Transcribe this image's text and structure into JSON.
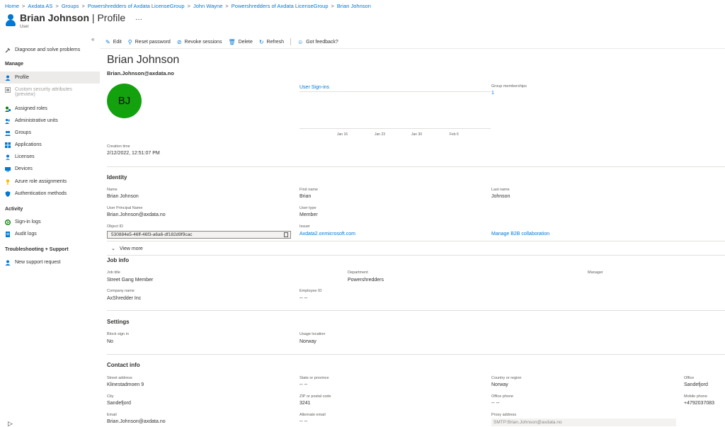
{
  "breadcrumb": [
    "Home",
    "Axdata AS",
    "Groups",
    "Powershredders of Axdata LicenseGroup",
    "John Wayne",
    "Powershredders of Axdata LicenseGroup",
    "Brian Johnson"
  ],
  "header": {
    "name": "Brian Johnson",
    "page": "Profile",
    "subtitle": "User",
    "more": "···"
  },
  "sidebar": {
    "collapse": "«",
    "diagnose": "Diagnose and solve problems",
    "manage_head": "Manage",
    "manage": [
      {
        "label": "Profile",
        "icon": "user-icon",
        "color": "#0078d4"
      },
      {
        "label": "Custom security attributes",
        "label2": "(preview)",
        "icon": "security-attributes-icon",
        "color": "#a19f9d"
      },
      {
        "label": "Assigned roles",
        "icon": "roles-icon",
        "color": "#107c10"
      },
      {
        "label": "Administrative units",
        "icon": "admin-units-icon",
        "color": "#0078d4"
      },
      {
        "label": "Groups",
        "icon": "groups-icon",
        "color": "#0078d4"
      },
      {
        "label": "Applications",
        "icon": "applications-icon",
        "color": "#0078d4"
      },
      {
        "label": "Licenses",
        "icon": "licenses-icon",
        "color": "#0078d4"
      },
      {
        "label": "Devices",
        "icon": "devices-icon",
        "color": "#0078d4"
      },
      {
        "label": "Azure role assignments",
        "icon": "key-icon",
        "color": "#ffb900"
      },
      {
        "label": "Authentication methods",
        "icon": "shield-icon",
        "color": "#0078d4"
      }
    ],
    "activity_head": "Activity",
    "activity": [
      {
        "label": "Sign-in logs",
        "icon": "signin-icon",
        "color": "#107c10"
      },
      {
        "label": "Audit logs",
        "icon": "audit-icon",
        "color": "#0078d4"
      }
    ],
    "trouble_head": "Troubleshooting + Support",
    "support": {
      "label": "New support request",
      "icon": "support-icon",
      "color": "#0078d4"
    }
  },
  "toolbar": {
    "edit": "Edit",
    "reset": "Reset password",
    "revoke": "Revoke sessions",
    "delete": "Delete",
    "refresh": "Refresh",
    "feedback": "Got feedback?"
  },
  "profile": {
    "name": "Brian Johnson",
    "upn": "Brian.Johnson@axdata.no",
    "initials": "BJ",
    "avatar_color": "#13a10e",
    "signins_link": "User Sign-ins",
    "chart_ticks": [
      "Jan 16",
      "Jan 23",
      "Jan 30",
      "Feb 6"
    ],
    "group_memberships_label": "Group memberships",
    "group_memberships_value": "1",
    "creation_label": "Creation time",
    "creation_value": "2/12/2022, 12:51:07 PM"
  },
  "identity": {
    "title": "Identity",
    "name_label": "Name",
    "name": "Brian Johnson",
    "first_label": "First name",
    "first": "Brian",
    "last_label": "Last name",
    "last": "Johnson",
    "upn_label": "User Principal Name",
    "upn": "Brian.Johnson@axdata.no",
    "type_label": "User type",
    "type": "Member",
    "objid_label": "Object ID",
    "objid": "530884e5-46ff-46f3-a6a6-df182d9f9cac",
    "issuer_label": "Issuer",
    "issuer": "Axdata2.onmicrosoft.com",
    "b2b": "Manage B2B collaboration",
    "view_more": "View more"
  },
  "job": {
    "title": "Job info",
    "jobtitle_label": "Job title",
    "jobtitle": "Street Gang Member",
    "dept_label": "Department",
    "dept": "Powershredders",
    "manager_label": "Manager",
    "company_label": "Company name",
    "company": "AxShredder Inc",
    "empid_label": "Employee ID",
    "empid": "-- --"
  },
  "settings": {
    "title": "Settings",
    "block_label": "Block sign in",
    "block": "No",
    "usage_label": "Usage location",
    "usage": "Norway"
  },
  "contact": {
    "title": "Contact info",
    "street_label": "Street address",
    "street": "Klinestadmoen 9",
    "state_label": "State or province",
    "state": "-- --",
    "country_label": "Country or region",
    "country": "Norway",
    "office_label": "Office",
    "office": "Sandefjord",
    "city_label": "City",
    "city": "Sandefjord",
    "zip_label": "ZIP or postal code",
    "zip": "3241",
    "ophone_label": "Office phone",
    "ophone": "-- --",
    "mobile_label": "Mobile phone",
    "mobile": "+4792037083",
    "email_label": "Email",
    "email": "Brian.Johnson@axdata.no",
    "altemail_label": "Alternate email",
    "altemail": "-- --",
    "proxy_label": "Proxy address",
    "proxy": "SMTP:Brian.Johnson@axdata.no"
  }
}
